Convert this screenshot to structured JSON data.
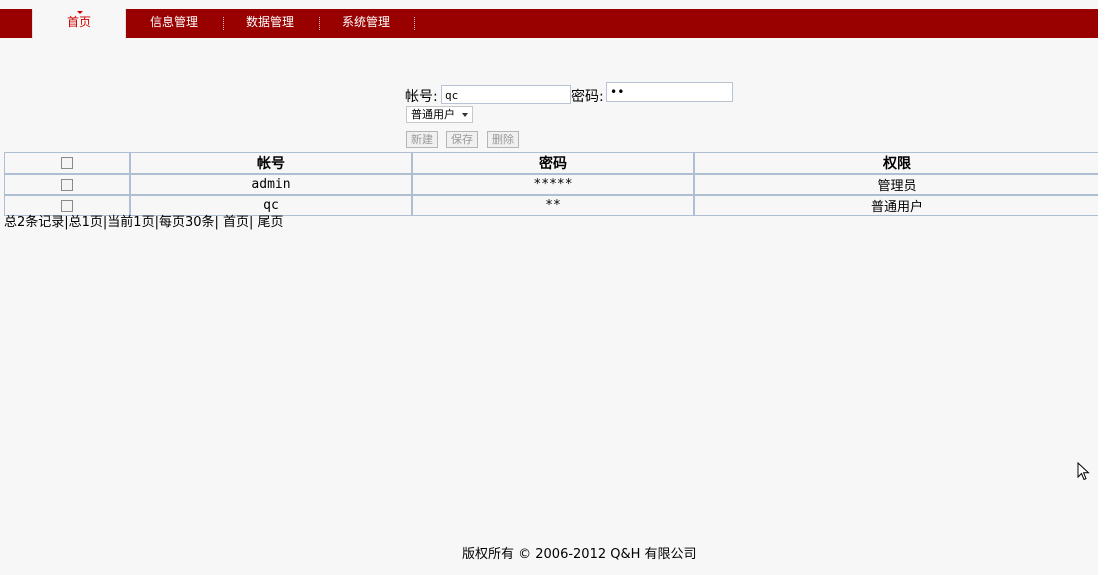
{
  "nav": {
    "tabs": [
      {
        "label": "首页",
        "active": true
      },
      {
        "label": "信息管理",
        "active": false
      },
      {
        "label": "数据管理",
        "active": false
      },
      {
        "label": "系统管理",
        "active": false
      }
    ],
    "active_color": "#cc0000",
    "bar_color": "#990000"
  },
  "form": {
    "account_label": "帐号:",
    "account_value": "qc",
    "password_label": "密码:",
    "password_value": "••",
    "role_selected": "普通用户",
    "buttons": {
      "new": "新建",
      "save": "保存",
      "delete": "删除"
    }
  },
  "table": {
    "headers": {
      "account": "帐号",
      "password": "密码",
      "role": "权限"
    },
    "rows": [
      {
        "account": "admin",
        "password": "*****",
        "role": "管理员"
      },
      {
        "account": "qc",
        "password": "**",
        "role": "普通用户"
      }
    ]
  },
  "pager": {
    "text": "总2条记录|总1页|当前1页|每页30条| 首页| 尾页"
  },
  "footer": {
    "text": "版权所有 © 2006-2012 Q&H 有限公司"
  }
}
